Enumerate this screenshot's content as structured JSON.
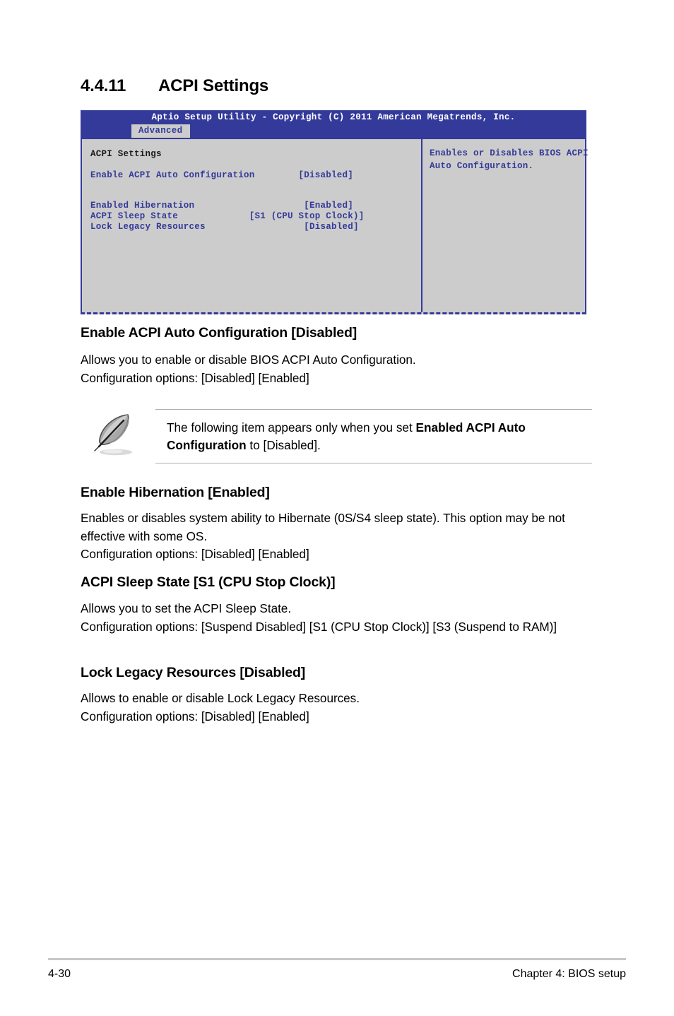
{
  "heading": {
    "number": "4.4.11",
    "title": "ACPI Settings"
  },
  "bios": {
    "titlebar": "Aptio Setup Utility - Copyright (C) 2011 American Megatrends, Inc.",
    "tab": "Advanced",
    "group_title": "ACPI Settings",
    "items": [
      {
        "label": "Enable ACPI Auto Configuration",
        "value": "[Disabled]"
      },
      {
        "label": "Enabled Hibernation",
        "value": "[Enabled]"
      },
      {
        "label": "ACPI Sleep State",
        "value": "[S1 (CPU Stop Clock)]"
      },
      {
        "label": "Lock Legacy Resources",
        "value": "[Disabled]"
      }
    ],
    "rows": [
      "Enable ACPI Auto Configuration        [Disabled]",
      "Enabled Hibernation                    [Enabled]",
      "ACPI Sleep State             [S1 (CPU Stop Clock)]",
      "Lock Legacy Resources                  [Disabled]"
    ],
    "help_line1": "Enables or Disables BIOS ACPI",
    "help_line2": "Auto Configuration.",
    "colors": {
      "header_blue": "#343a99",
      "panel_gray": "#cccccc"
    }
  },
  "sections": [
    {
      "heading": "Enable ACPI Auto Configuration [Disabled]",
      "line1": "Allows you to enable or disable BIOS ACPI Auto Configuration.",
      "line2": "Configuration options: [Disabled] [Enabled]"
    },
    {
      "heading": "Enable Hibernation [Enabled]",
      "line1": "Enables or disables system ability to Hibernate (0S/S4 sleep state). This option may be not effective with some OS.",
      "line2": "Configuration options: [Disabled] [Enabled]"
    },
    {
      "heading": "ACPI Sleep State [S1 (CPU Stop Clock)]",
      "line1": "Allows you to set the ACPI Sleep State.",
      "line2": "Configuration options: [Suspend Disabled] [S1 (CPU Stop Clock)] [S3 (Suspend to RAM)]"
    },
    {
      "heading": "Lock Legacy Resources [Disabled]",
      "line1": "Allows to enable or disable Lock Legacy Resources.",
      "line2": "Configuration options: [Disabled] [Enabled]"
    }
  ],
  "note": {
    "text_part1": "The following item appears only when you set ",
    "bold1": "Enabled ACPI Auto Configuration",
    "text_part2": " to [Disabled]."
  },
  "footer": {
    "page_number": "4-30",
    "chapter": "Chapter 4: BIOS setup"
  }
}
